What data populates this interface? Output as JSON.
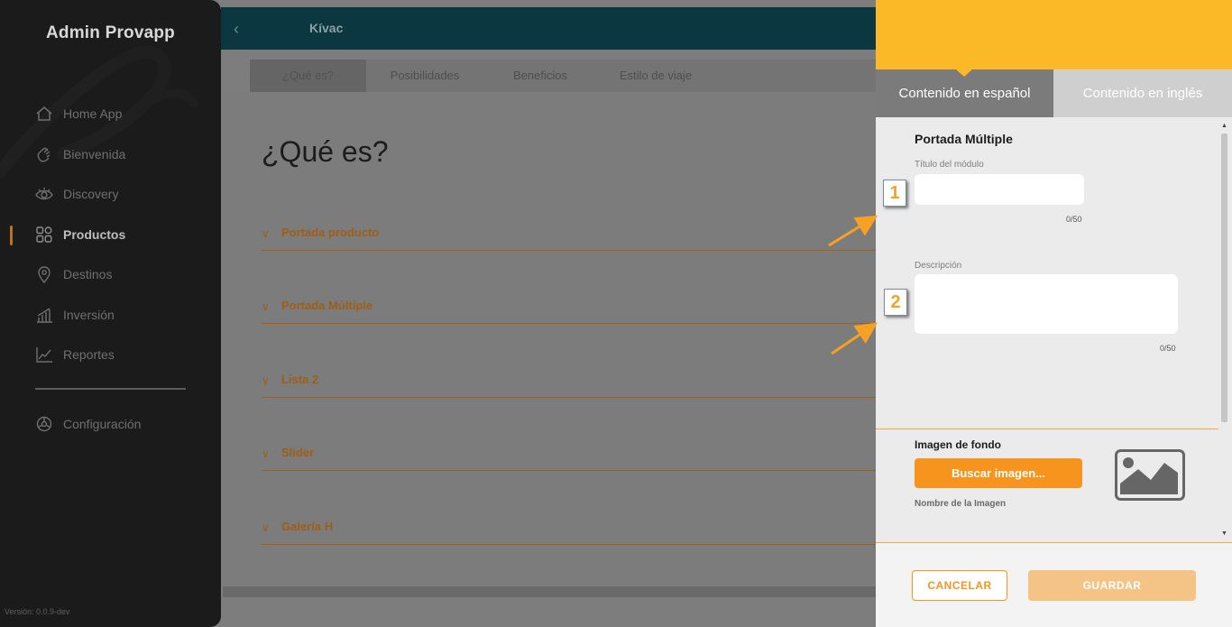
{
  "sidebar": {
    "brand": "Admin Provapp",
    "version": "Versión: 0.0.9-dev",
    "items": [
      {
        "label": "Home App",
        "icon": "home-icon"
      },
      {
        "label": "Bienvenida",
        "icon": "wave-hand-icon"
      },
      {
        "label": "Discovery",
        "icon": "eye-icon"
      },
      {
        "label": "Productos",
        "icon": "grid-icon",
        "active": true
      },
      {
        "label": "Destinos",
        "icon": "location-pin-icon"
      },
      {
        "label": "Inversión",
        "icon": "bar-chart-icon"
      },
      {
        "label": "Reportes",
        "icon": "line-chart-icon"
      },
      {
        "label": "Configuración",
        "icon": "gear-icon"
      }
    ]
  },
  "topbar": {
    "title": "Kívac",
    "back_icon": "chevron-left-icon"
  },
  "tabs": [
    "¿Qué es?",
    "Posibilidades",
    "Beneficios",
    "Estilo de viaje"
  ],
  "main": {
    "title": "¿Qué es?",
    "accordions": [
      "Portada producto",
      "Portada Múltiple",
      "Lista 2",
      "Slider",
      "Galería H"
    ]
  },
  "panel": {
    "tab_es": "Contenido en español",
    "tab_en": "Contenido en inglés",
    "section_title": "Portada Múltiple",
    "titulo_label": "Título del módulo",
    "titulo_value": "",
    "titulo_count": "0/50",
    "descripcion_label": "Descripción",
    "descripcion_value": "",
    "descripcion_count": "0/50",
    "imagen_title": "Imagen de fondo",
    "buscar_label": "Buscar imagen...",
    "imagen_nombre": "Nombre de la Imagen",
    "cancel_label": "CANCELAR",
    "save_label": "GUARDAR"
  },
  "annotations": {
    "marker_1": "1",
    "marker_2": "2"
  },
  "colors": {
    "accent": "#f7941d",
    "header": "#fbb827",
    "topbar": "#0b3741"
  }
}
